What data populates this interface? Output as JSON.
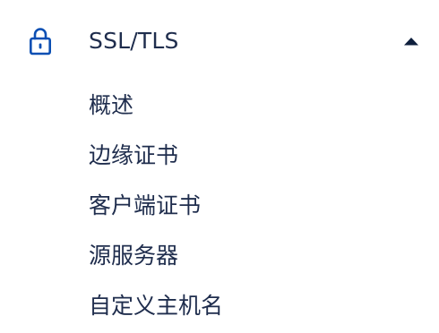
{
  "nav": {
    "section": {
      "label": "SSL/TLS",
      "icon": "lock-icon",
      "toggle_icon": "caret-up-icon",
      "expanded": true,
      "accent_color": "#0b4fb3",
      "items": [
        {
          "label": "概述"
        },
        {
          "label": "边缘证书"
        },
        {
          "label": "客户端证书"
        },
        {
          "label": "源服务器"
        },
        {
          "label": "自定义主机名"
        }
      ]
    }
  }
}
